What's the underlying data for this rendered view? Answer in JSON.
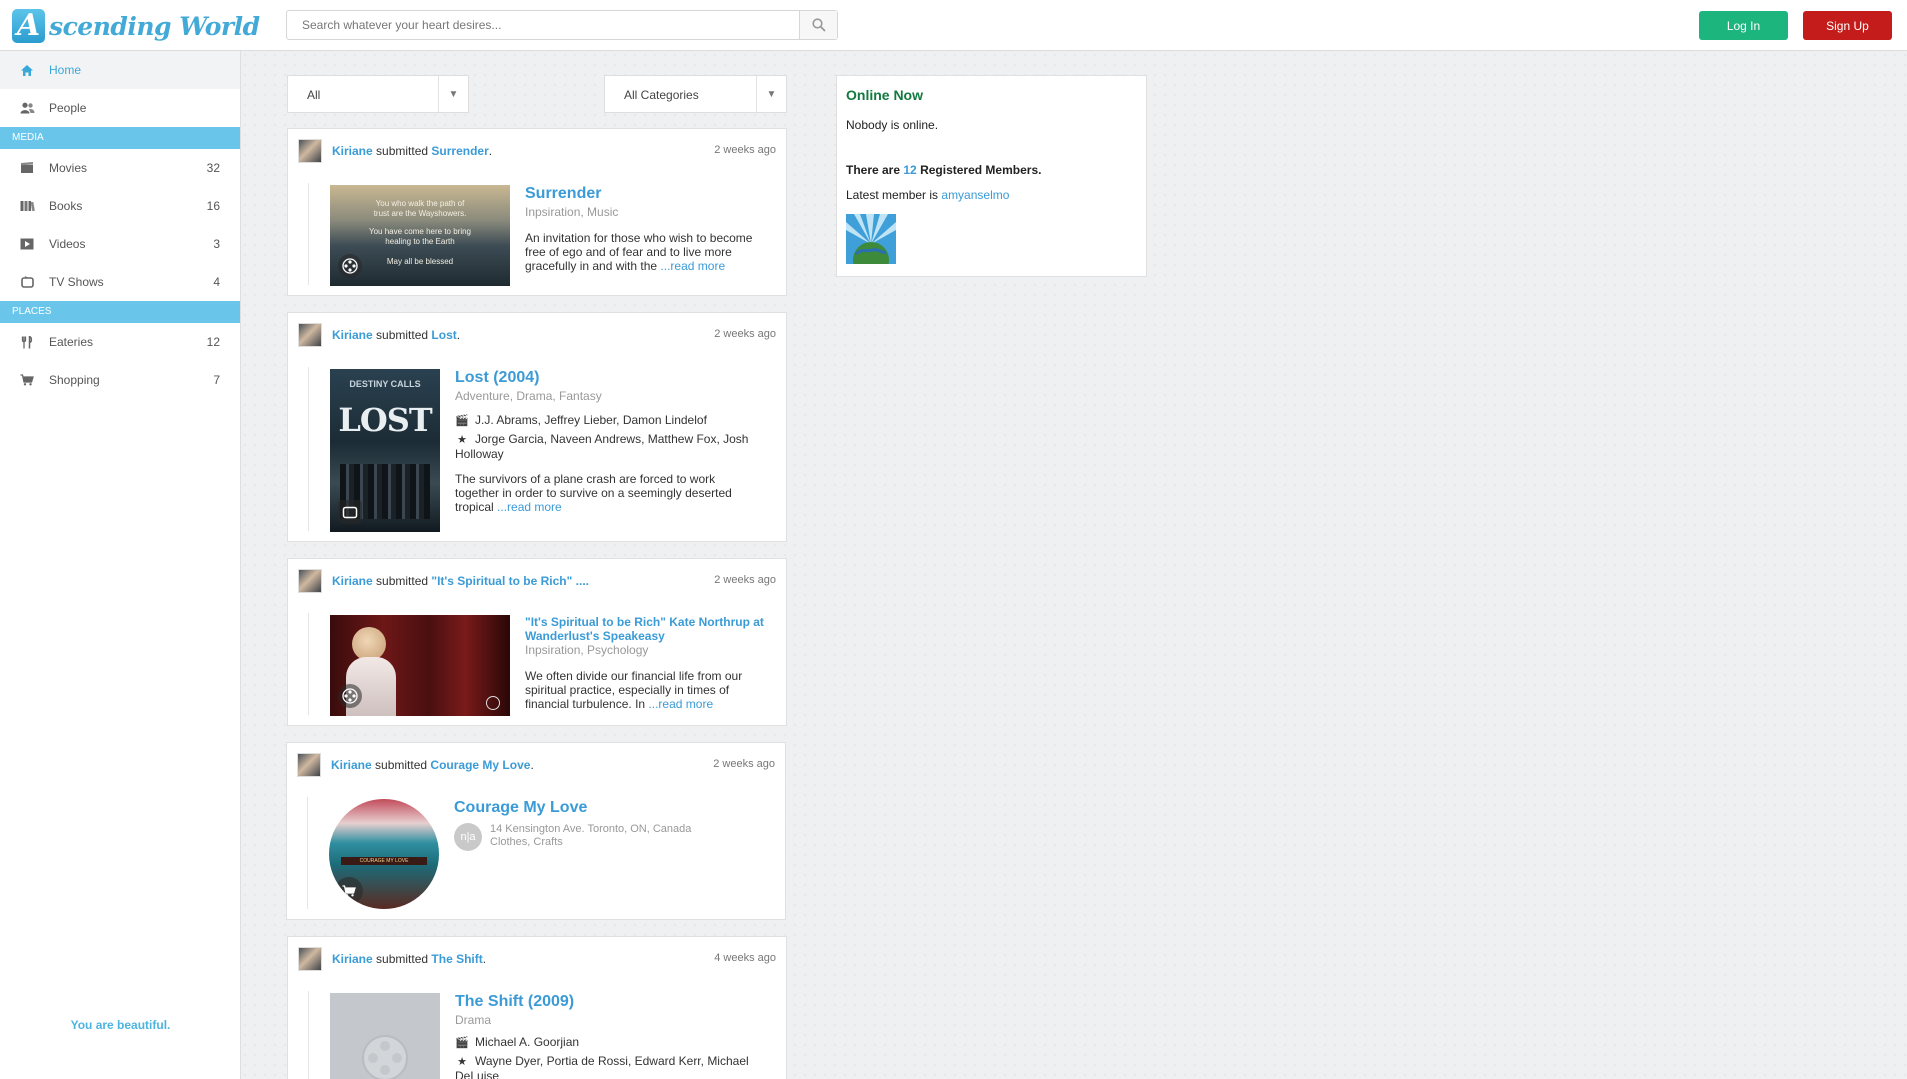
{
  "header": {
    "logo_letter": "A",
    "logo_text": "scending World",
    "search_placeholder": "Search whatever your heart desires...",
    "login_label": "Log In",
    "signup_label": "Sign Up"
  },
  "sidebar": {
    "home": "Home",
    "people": "People",
    "media_section": "MEDIA",
    "media": [
      {
        "label": "Movies",
        "count": "32",
        "icon": "film-icon"
      },
      {
        "label": "Books",
        "count": "16",
        "icon": "book-icon"
      },
      {
        "label": "Videos",
        "count": "3",
        "icon": "play-icon"
      },
      {
        "label": "TV Shows",
        "count": "4",
        "icon": "tv-icon"
      }
    ],
    "places_section": "PLACES",
    "places": [
      {
        "label": "Eateries",
        "count": "12",
        "icon": "fork-knife-icon"
      },
      {
        "label": "Shopping",
        "count": "7",
        "icon": "cart-icon"
      }
    ],
    "footer": "You are beautiful."
  },
  "filters": {
    "type": "All",
    "category": "All Categories"
  },
  "feed": [
    {
      "user": "Kiriane",
      "verb": "submitted",
      "item": "Surrender",
      "time": "2 weeks ago",
      "title": "Surrender",
      "subtitle": "Inpsiration, Music",
      "thumb_lines": [
        "You who walk the path of",
        "trust are the Wayshowers.",
        "You have come here to bring",
        "healing to the Earth",
        "May all be blessed"
      ],
      "desc": "An invitation for those who wish to become free of ego and of fear and to live more gracefully in and with the",
      "read_more": "...read more"
    },
    {
      "user": "Kiriane",
      "verb": "submitted",
      "item": "Lost",
      "time": "2 weeks ago",
      "title": "Lost (2004)",
      "subtitle": "Adventure, Drama, Fantasy",
      "thumb_top": "DESTINY CALLS",
      "thumb_title": "LOST",
      "director": "J.J. Abrams, Jeffrey Lieber, Damon Lindelof",
      "stars": "Jorge Garcia, Naveen Andrews, Matthew Fox, Josh Holloway",
      "desc": "The survivors of a plane crash are forced to work together in order to survive on a seemingly deserted tropical",
      "read_more": "...read more"
    },
    {
      "user": "Kiriane",
      "verb": "submitted",
      "item": "\"It's Spiritual to be Rich\" ....",
      "time": "2 weeks ago",
      "title": "\"It's Spiritual to be Rich\" Kate Northrup at Wanderlust's Speakeasy",
      "subtitle": "Inpsiration, Psychology",
      "desc": "We often divide our financial life from our spiritual practice, especially in times of financial turbulence. In",
      "read_more": "...read more"
    },
    {
      "user": "Kiriane",
      "verb": "submitted",
      "item": "Courage My Love",
      "time": "2 weeks ago",
      "title": "Courage My Love",
      "rating": "n|a",
      "address": "14 Kensington Ave. Toronto, ON, Canada",
      "tags": "Clothes, Crafts",
      "sign": "COURAGE MY LOVE"
    },
    {
      "user": "Kiriane",
      "verb": "submitted",
      "item": "The Shift",
      "time": "4 weeks ago",
      "title": "The Shift (2009)",
      "subtitle": "Drama",
      "director": "Michael A. Goorjian",
      "stars": "Wayne Dyer, Portia de Rossi, Edward Kerr, Michael DeLuise"
    }
  ],
  "online": {
    "title": "Online Now",
    "status": "Nobody is online.",
    "reg_prefix": "There are",
    "reg_count": "12",
    "reg_suffix": "Registered Members.",
    "latest_prefix": "Latest member is",
    "latest_member": "amyanselmo"
  }
}
